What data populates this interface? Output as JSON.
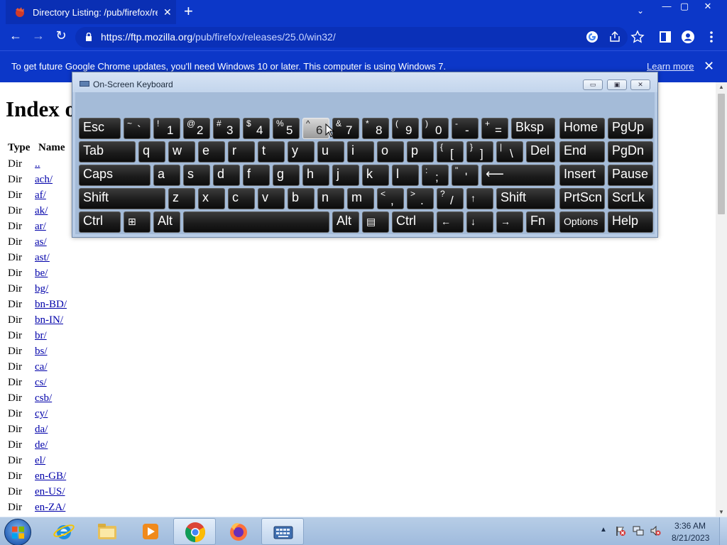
{
  "browser": {
    "tab_title": "Directory Listing: /pub/firefox/rel",
    "tab_close": "✕",
    "new_tab": "+",
    "tab_search": "⌄",
    "minimize": "—",
    "maximize": "▢",
    "close": "✕",
    "back": "←",
    "forward": "→",
    "reload": "↻",
    "url_host": "https://ftp.mozilla.org",
    "url_path": "/pub/firefox/releases/25.0/win32/"
  },
  "infobar": {
    "message": "To get future Google Chrome updates, you'll need Windows 10 or later. This computer is using Windows 7.",
    "learn_more": "Learn more",
    "close": "✕"
  },
  "page": {
    "heading": "Index of /pub/firefox/releases/25.0/win32/",
    "col_type": "Type",
    "col_name": "Name",
    "rows": [
      {
        "type": "Dir",
        "name": ".."
      },
      {
        "type": "Dir",
        "name": "ach/"
      },
      {
        "type": "Dir",
        "name": "af/"
      },
      {
        "type": "Dir",
        "name": "ak/"
      },
      {
        "type": "Dir",
        "name": "ar/"
      },
      {
        "type": "Dir",
        "name": "as/"
      },
      {
        "type": "Dir",
        "name": "ast/"
      },
      {
        "type": "Dir",
        "name": "be/"
      },
      {
        "type": "Dir",
        "name": "bg/"
      },
      {
        "type": "Dir",
        "name": "bn-BD/"
      },
      {
        "type": "Dir",
        "name": "bn-IN/"
      },
      {
        "type": "Dir",
        "name": "br/"
      },
      {
        "type": "Dir",
        "name": "bs/"
      },
      {
        "type": "Dir",
        "name": "ca/"
      },
      {
        "type": "Dir",
        "name": "cs/"
      },
      {
        "type": "Dir",
        "name": "csb/"
      },
      {
        "type": "Dir",
        "name": "cy/"
      },
      {
        "type": "Dir",
        "name": "da/"
      },
      {
        "type": "Dir",
        "name": "de/"
      },
      {
        "type": "Dir",
        "name": "el/"
      },
      {
        "type": "Dir",
        "name": "en-GB/"
      },
      {
        "type": "Dir",
        "name": "en-US/"
      },
      {
        "type": "Dir",
        "name": "en-ZA/"
      }
    ]
  },
  "osk": {
    "title": "On-Screen Keyboard",
    "minimize": "▭",
    "restore": "▣",
    "close": "✕",
    "keys": {
      "esc": "Esc",
      "tilde_up": "~",
      "tilde_lo": "`",
      "k1_up": "!",
      "k1": "1",
      "k2_up": "@",
      "k2": "2",
      "k3_up": "#",
      "k3": "3",
      "k4_up": "$",
      "k4": "4",
      "k5_up": "%",
      "k5": "5",
      "k6_up": "^",
      "k6": "6",
      "k7_up": "&",
      "k7": "7",
      "k8_up": "*",
      "k8": "8",
      "k9_up": "(",
      "k9": "9",
      "k0_up": ")",
      "k0": "0",
      "minus_up": "-",
      "minus_lo": "-",
      "plus_up": "+",
      "plus_lo": "=",
      "bksp": "Bksp",
      "home": "Home",
      "pgup": "PgUp",
      "tab": "Tab",
      "q": "q",
      "w": "w",
      "e": "e",
      "r": "r",
      "t": "t",
      "y": "y",
      "u": "u",
      "i": "i",
      "o": "o",
      "p": "p",
      "lbr_up": "{",
      "lbr": "[",
      "rbr_up": "}",
      "rbr": "]",
      "bs_up": "|",
      "bs": "\\",
      "del": "Del",
      "end": "End",
      "pgdn": "PgDn",
      "caps": "Caps",
      "a": "a",
      "s": "s",
      "d": "d",
      "f": "f",
      "g": "g",
      "h": "h",
      "j": "j",
      "k": "k",
      "l": "l",
      "semi_up": ":",
      "semi": ";",
      "quote_up": "\"",
      "quote": "'",
      "enter": "⟵",
      "insert": "Insert",
      "pause": "Pause",
      "shift": "Shift",
      "z": "z",
      "x": "x",
      "c": "c",
      "v": "v",
      "b": "b",
      "n": "n",
      "m": "m",
      "comma_up": "<",
      "comma": ",",
      "dot_up": ">",
      "dot": ".",
      "slash_up": "?",
      "slash": "/",
      "up": "↑",
      "shift_r": "Shift",
      "prtscn": "PrtScn",
      "scrlk": "ScrLk",
      "ctrl": "Ctrl",
      "win": "⊞",
      "alt": "Alt",
      "space": "",
      "alt_r": "Alt",
      "menu": "▤",
      "ctrl_r": "Ctrl",
      "left": "←",
      "down": "↓",
      "right": "→",
      "fn": "Fn",
      "options": "Options",
      "help": "Help"
    }
  },
  "taskbar": {
    "time": "3:36 AM",
    "date": "8/21/2023",
    "tray_arrow": "▲"
  }
}
